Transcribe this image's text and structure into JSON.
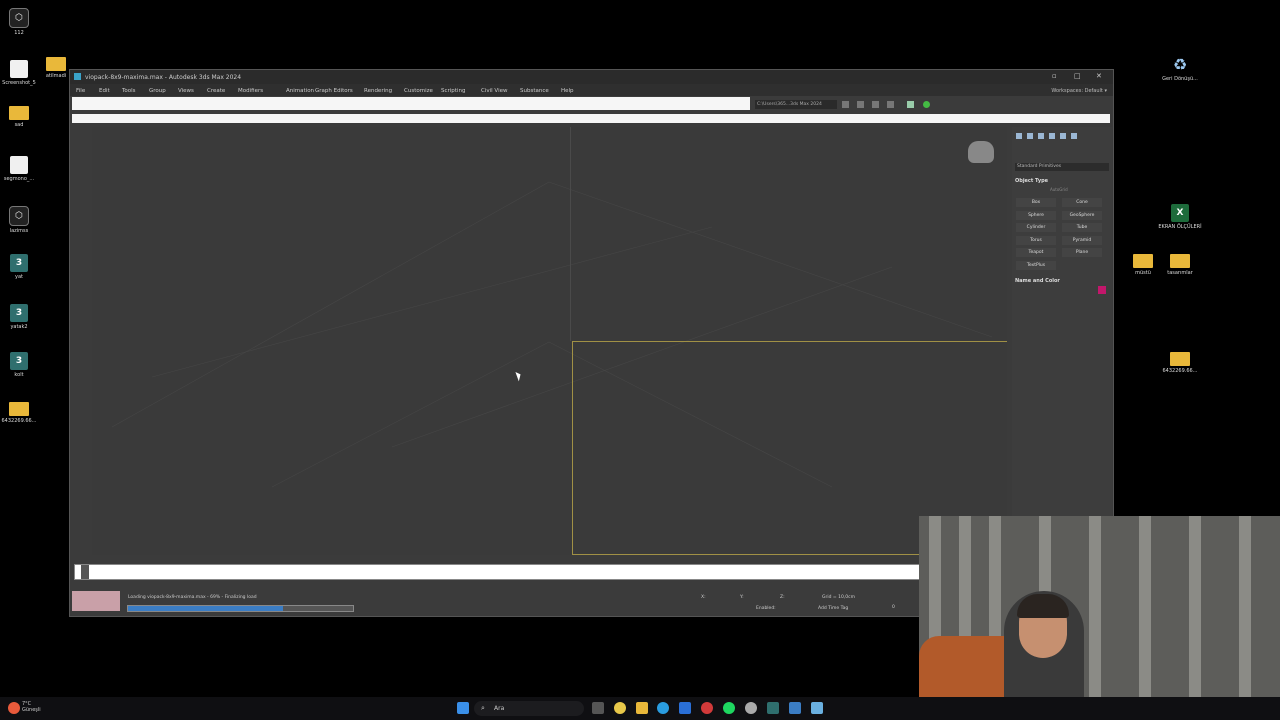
{
  "desktop": {
    "left_icons": [
      {
        "label": "112",
        "kind": "app"
      },
      {
        "label": "Screenshot_5",
        "kind": "white"
      },
      {
        "label": "atilmadi",
        "kind": "folder"
      },
      {
        "label": "sad",
        "kind": "folder"
      },
      {
        "label": "segmono_...",
        "kind": "white"
      },
      {
        "label": "lazimss",
        "kind": "app"
      },
      {
        "label": "yat",
        "kind": "max"
      },
      {
        "label": "yatak2",
        "kind": "max"
      },
      {
        "label": "kolt",
        "kind": "max"
      },
      {
        "label": "6432269.66...",
        "kind": "folder"
      }
    ],
    "right_icons": [
      {
        "label": "Geri Dönüşü...",
        "kind": "recycle"
      },
      {
        "label": "EKRAN ÖLÇÜLERİ",
        "kind": "excel"
      },
      {
        "label": "müstü",
        "kind": "folder"
      },
      {
        "label": "tasarımlar",
        "kind": "folder"
      },
      {
        "label": "6432269.66...",
        "kind": "folder"
      }
    ]
  },
  "window": {
    "title": "viopack-8x9-maxima.max - Autodesk 3ds Max 2024",
    "menus": [
      "File",
      "Edit",
      "Tools",
      "Group",
      "Views",
      "Create",
      "Modifiers",
      "Animation",
      "Graph Editors",
      "Rendering",
      "Customize",
      "Scripting",
      "Civil View",
      "Substance",
      "Help"
    ],
    "workspaces_label": "Workspaces:",
    "workspaces_value": "Default",
    "path": "C:\\Users\\365...3ds Max 2024"
  },
  "command_panel": {
    "category": "Standard Primitives",
    "object_type_label": "Object Type",
    "autogrid": "AutoGrid",
    "primitives": [
      "Box",
      "Cone",
      "Sphere",
      "GeoSphere",
      "Cylinder",
      "Tube",
      "Torus",
      "Pyramid",
      "Teapot",
      "Plane",
      "TextPlus"
    ],
    "name_color_label": "Name and Color",
    "color": "#c2176b"
  },
  "status": {
    "loading_text": "Loading viopack-8x9-maxima.max - 69% - Finalizing load",
    "progress_percent": 69,
    "x_label": "X:",
    "y_label": "Y:",
    "z_label": "Z:",
    "grid_text": "Grid = 10,0cm",
    "enabled_label": "Enabled:",
    "add_time_tag": "Add Time Tag",
    "frame": "0"
  },
  "taskbar": {
    "weather_temp": "7°C",
    "weather_desc": "Güneşli",
    "search_label": "Ara"
  }
}
